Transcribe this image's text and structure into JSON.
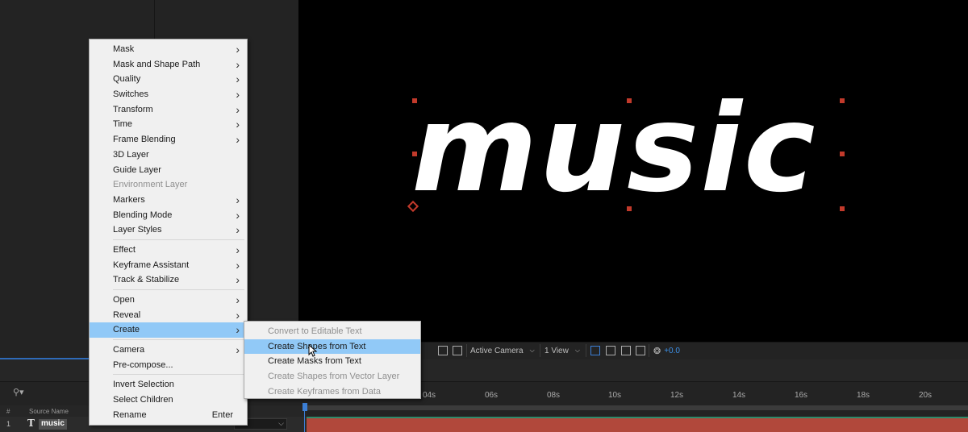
{
  "composition": {
    "layer_text": "music"
  },
  "viewer_bar": {
    "camera": "Active Camera",
    "views": "1 View",
    "exposure": "+0.0"
  },
  "timeline": {
    "header": {
      "num_col": "#",
      "source_col": "Source Name"
    },
    "ruler_ticks": [
      "04s",
      "06s",
      "08s",
      "10s",
      "12s",
      "14s",
      "16s",
      "18s",
      "20s"
    ],
    "layers": [
      {
        "index": "1",
        "type_icon": "T",
        "name": "music"
      }
    ]
  },
  "context_menu": {
    "items": [
      {
        "label": "Mask",
        "submenu": true
      },
      {
        "label": "Mask and Shape Path",
        "submenu": true
      },
      {
        "label": "Quality",
        "submenu": true
      },
      {
        "label": "Switches",
        "submenu": true
      },
      {
        "label": "Transform",
        "submenu": true
      },
      {
        "label": "Time",
        "submenu": true
      },
      {
        "label": "Frame Blending",
        "submenu": true
      },
      {
        "label": "3D Layer"
      },
      {
        "label": "Guide Layer"
      },
      {
        "label": "Environment Layer",
        "disabled": true
      },
      {
        "label": "Markers",
        "submenu": true
      },
      {
        "label": "Blending Mode",
        "submenu": true
      },
      {
        "label": "Layer Styles",
        "submenu": true
      },
      {
        "separator": true
      },
      {
        "label": "Effect",
        "submenu": true
      },
      {
        "label": "Keyframe Assistant",
        "submenu": true
      },
      {
        "label": "Track & Stabilize",
        "submenu": true
      },
      {
        "separator": true
      },
      {
        "label": "Open",
        "submenu": true
      },
      {
        "label": "Reveal",
        "submenu": true
      },
      {
        "label": "Create",
        "submenu": true,
        "highlight": true
      },
      {
        "separator": true
      },
      {
        "label": "Camera",
        "submenu": true
      },
      {
        "label": "Pre-compose..."
      },
      {
        "separator": true
      },
      {
        "label": "Invert Selection"
      },
      {
        "label": "Select Children"
      },
      {
        "label": "Rename",
        "shortcut": "Enter"
      }
    ]
  },
  "create_submenu": {
    "items": [
      {
        "label": "Convert to Editable Text",
        "disabled": true
      },
      {
        "label": "Create Shapes from Text",
        "highlight": true
      },
      {
        "label": "Create Masks from Text"
      },
      {
        "label": "Create Shapes from Vector Layer",
        "disabled": true
      },
      {
        "label": "Create Keyframes from Data",
        "disabled": true
      }
    ]
  }
}
